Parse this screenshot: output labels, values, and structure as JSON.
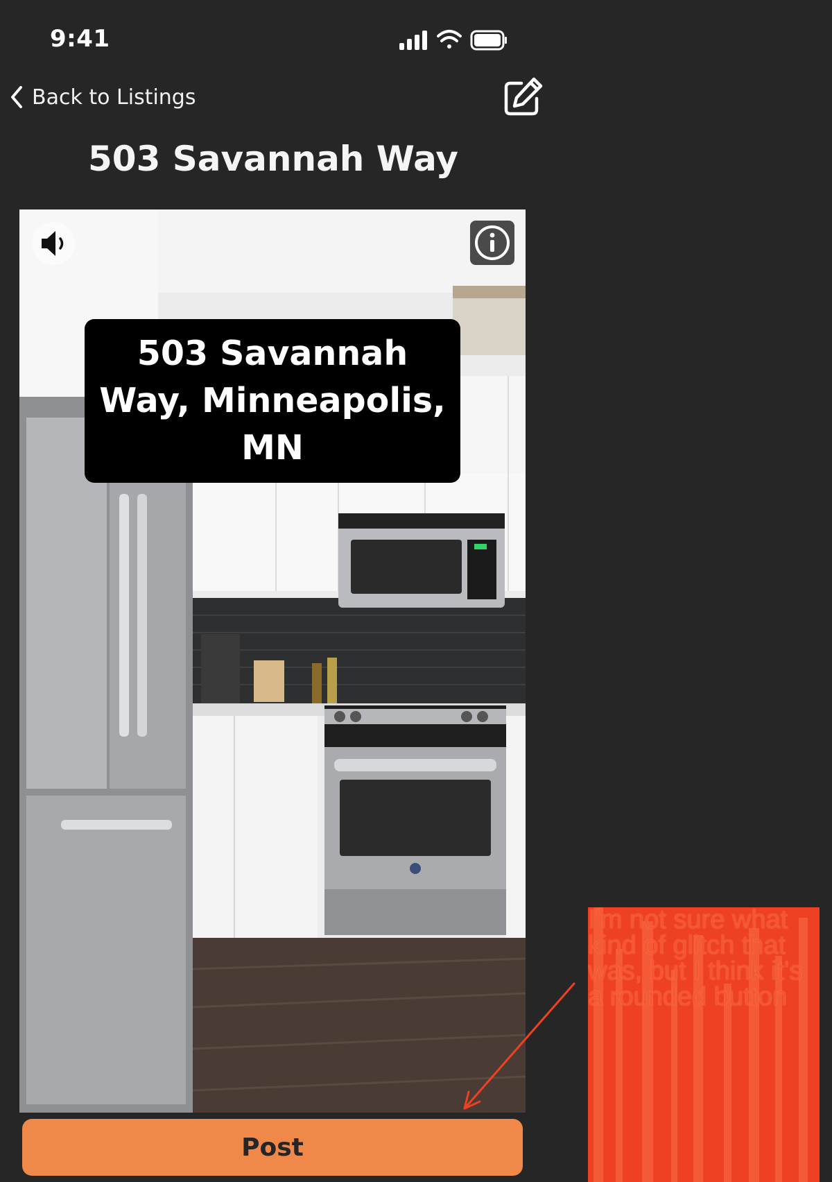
{
  "status_bar": {
    "time": "9:41"
  },
  "nav": {
    "back_label": "Back to Listings"
  },
  "page": {
    "title": "503 Savannah Way"
  },
  "media": {
    "overlay_address": "503 Savannah Way, Minneapolis, MN"
  },
  "actions": {
    "post_label": "Post"
  },
  "annotation": {
    "text": "I'm not sure what kind of glitch that was, but I think it's a rounded button"
  },
  "colors": {
    "background": "#262626",
    "accent": "#f0884a",
    "annotation": "#ee4123"
  }
}
